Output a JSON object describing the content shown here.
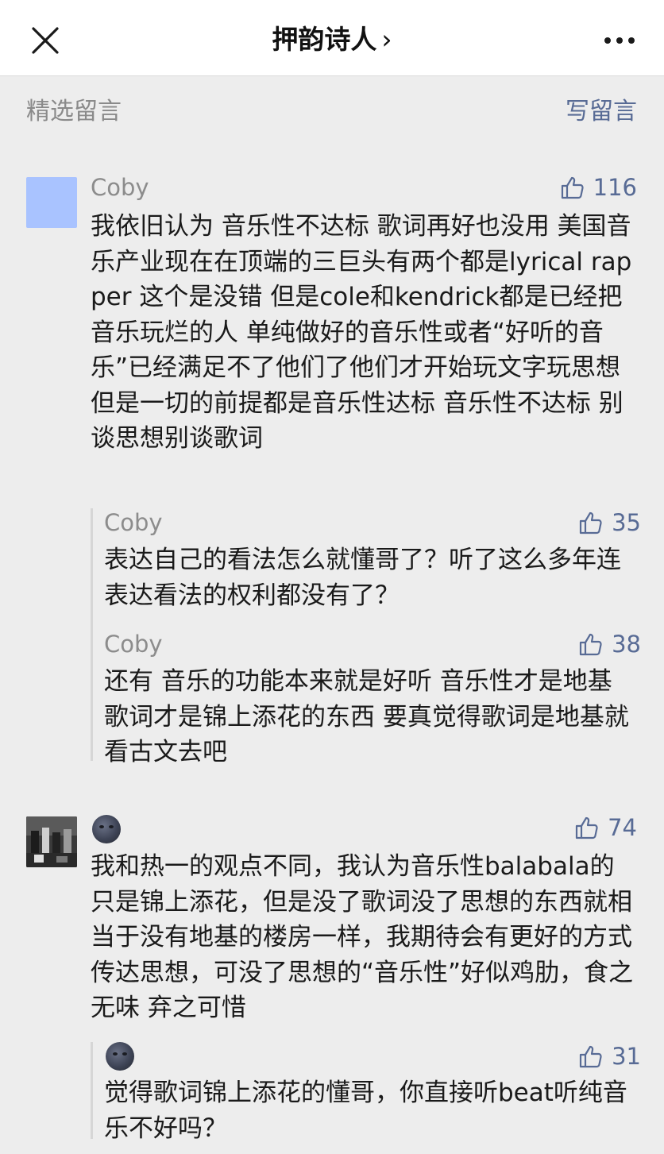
{
  "nav": {
    "title": "押韵诗人",
    "chevron": "›",
    "close_icon": "close-icon",
    "more_icon": "more-icon"
  },
  "section": {
    "title": "精选留言",
    "write_label": "写留言"
  },
  "comments": [
    {
      "name": "Coby",
      "likes": "116",
      "text": "我依旧认为 音乐性不达标 歌词再好也没用 美国音乐产业现在在顶端的三巨头有两个都是lyrical rapper 这个是没错 但是cole和kendrick都是已经把音乐玩烂的人 单纯做好的音乐性或者“好听的音乐”已经满足不了他们了他们才开始玩文字玩思想 但是一切的前提都是音乐性达标 音乐性不达标 别谈思想别谈歌词",
      "replies": [
        {
          "name": "Coby",
          "likes": "35",
          "text": "表达自己的看法怎么就懂哥了？听了这么多年连表达看法的权利都没有了？"
        },
        {
          "name": "Coby",
          "likes": "38",
          "text": "还有 音乐的功能本来就是好听 音乐性才是地基 歌词才是锦上添花的东西 要真觉得歌词是地基就看古文去吧"
        }
      ]
    },
    {
      "name_icon": "moon-emoji",
      "likes": "74",
      "text": "我和热一的观点不同，我认为音乐性balabala的只是锦上添花，但是没了歌词没了思想的东西就相当于没有地基的楼房一样，我期待会有更好的方式传达思想，可没了思想的“音乐性”好似鸡肋，食之无味 弃之可惜",
      "replies": [
        {
          "name_icon": "moon-emoji",
          "likes": "31",
          "text": "觉得歌词锦上添花的懂哥，你直接听beat听纯音乐不好吗？"
        }
      ]
    }
  ],
  "colors": {
    "background": "#ededed",
    "link": "#586b95",
    "muted": "#8c8c8c",
    "avatar_blue": "#a9c3ff"
  }
}
